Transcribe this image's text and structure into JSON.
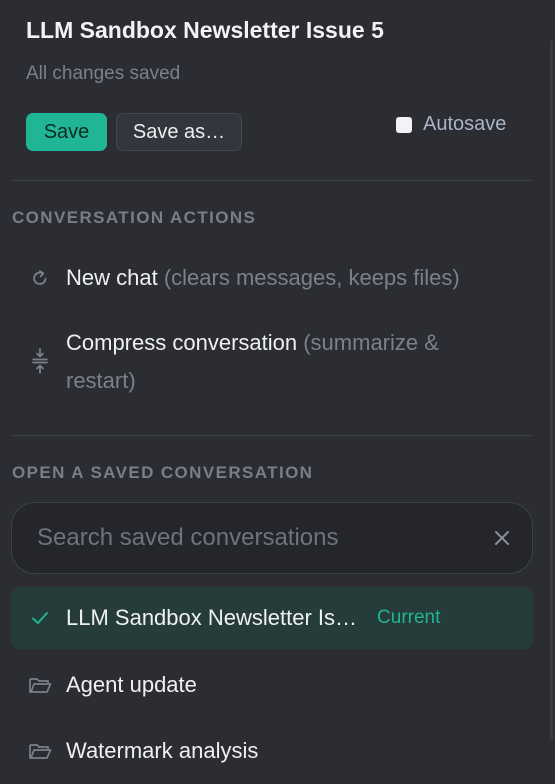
{
  "document": {
    "title": "LLM Sandbox Newsletter Issue 5",
    "status": "All changes saved"
  },
  "toolbar": {
    "save_label": "Save",
    "save_as_label": "Save as…",
    "autosave_label": "Autosave",
    "autosave_checked": false
  },
  "actions": {
    "heading": "CONVERSATION ACTIONS",
    "new_chat": {
      "label": "New chat",
      "hint": "(clears messages, keeps files)",
      "icon": "refresh-icon"
    },
    "compress": {
      "label": "Compress conversation",
      "hint": "(summarize & restart)",
      "icon": "compress-icon"
    }
  },
  "saved": {
    "heading": "OPEN A SAVED CONVERSATION",
    "search_placeholder": "Search saved conversations",
    "items": [
      {
        "label": "LLM Sandbox Newsletter Is…",
        "badge": "Current",
        "icon": "check-icon"
      },
      {
        "label": "Agent update",
        "icon": "folder-icon"
      },
      {
        "label": "Watermark analysis",
        "icon": "folder-icon"
      }
    ]
  },
  "colors": {
    "background": "#2b2d33",
    "accent": "#1fb595",
    "current_row": "#263c3a",
    "muted_text": "#7c808a"
  }
}
